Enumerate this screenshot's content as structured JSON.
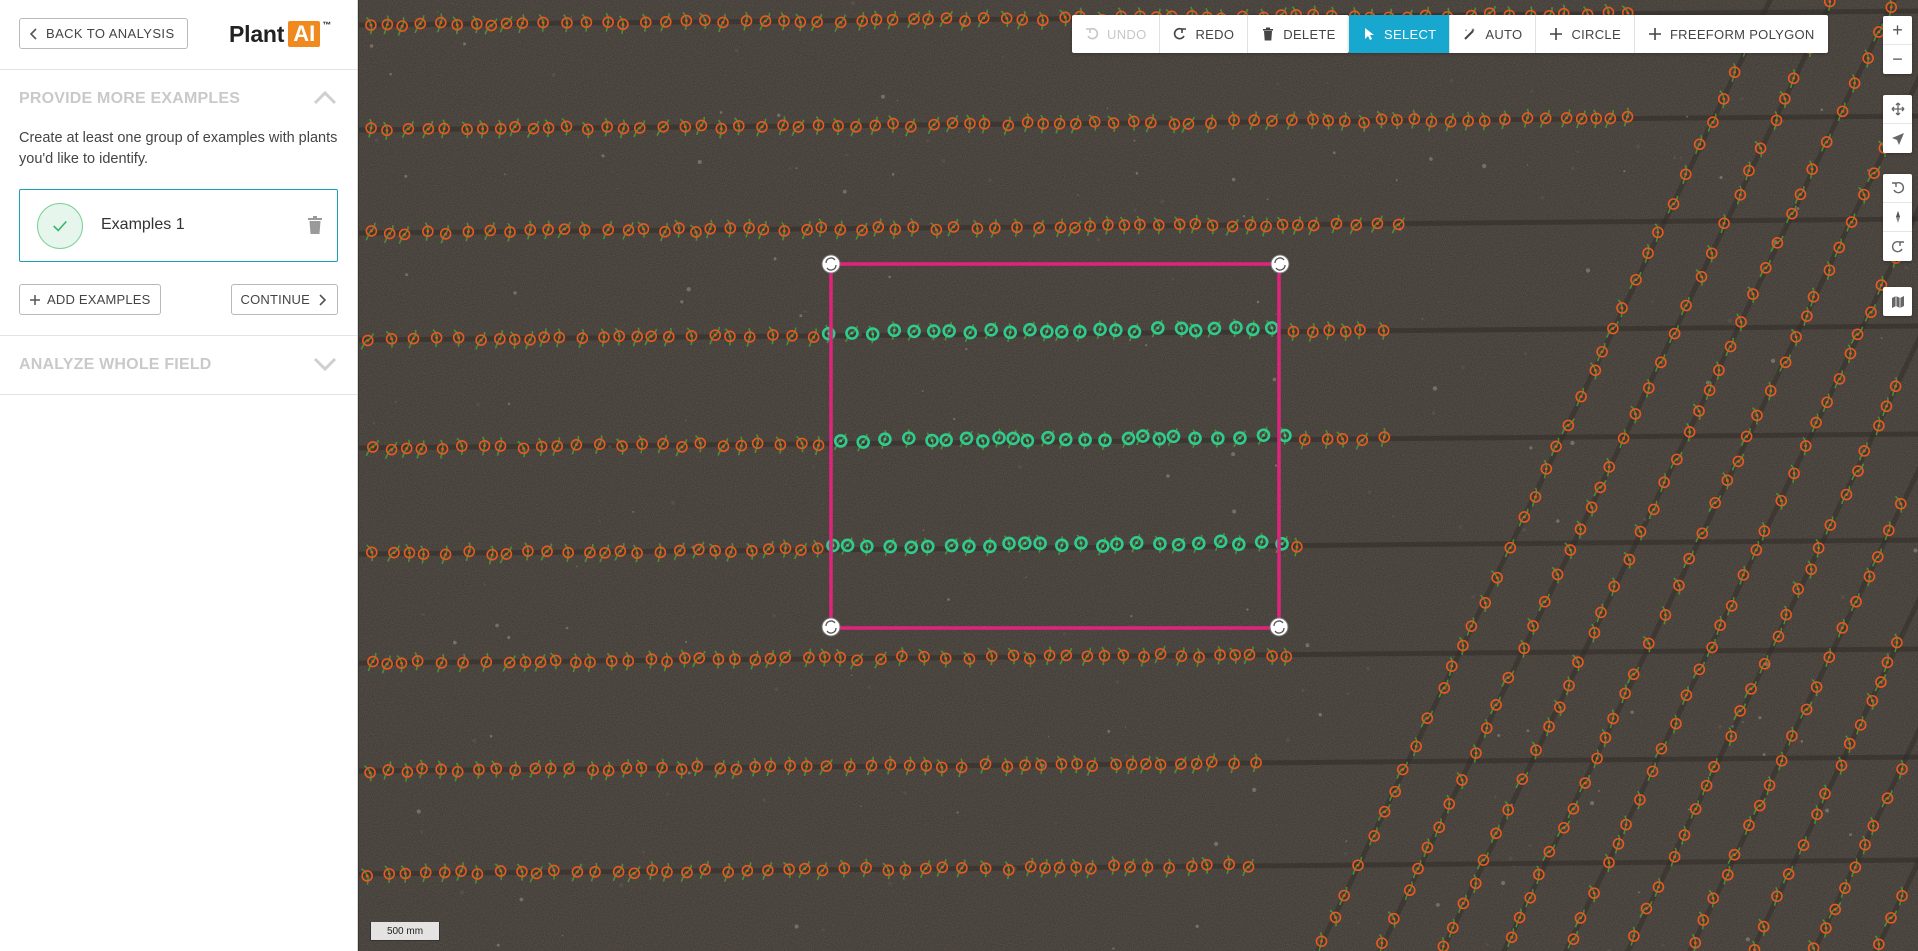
{
  "sidebar": {
    "back_label": "BACK TO ANALYSIS",
    "logo": {
      "plant": "Plant",
      "ai": "AI",
      "tm": "™"
    },
    "section1": {
      "title": "PROVIDE MORE EXAMPLES",
      "description": "Create at least one group of examples with plants you'd like to identify.",
      "examples": [
        {
          "label": "Examples 1"
        }
      ],
      "add_label": "ADD EXAMPLES",
      "continue_label": "CONTINUE"
    },
    "section2": {
      "title": "ANALYZE WHOLE FIELD"
    }
  },
  "toolbar": {
    "undo": "UNDO",
    "redo": "REDO",
    "delete": "DELETE",
    "select": "SELECT",
    "auto": "AUTO",
    "circle": "CIRCLE",
    "freeform": "FREEFORM POLYGON"
  },
  "map": {
    "scale_label": "500 mm",
    "zoom_in": "+",
    "zoom_out": "−"
  },
  "colors": {
    "accent": "#17a7cf",
    "selection": "#e0247d",
    "example_marker": "#2ecc8f",
    "detected_marker": "#e85a1e",
    "soil": "#3a342f"
  }
}
